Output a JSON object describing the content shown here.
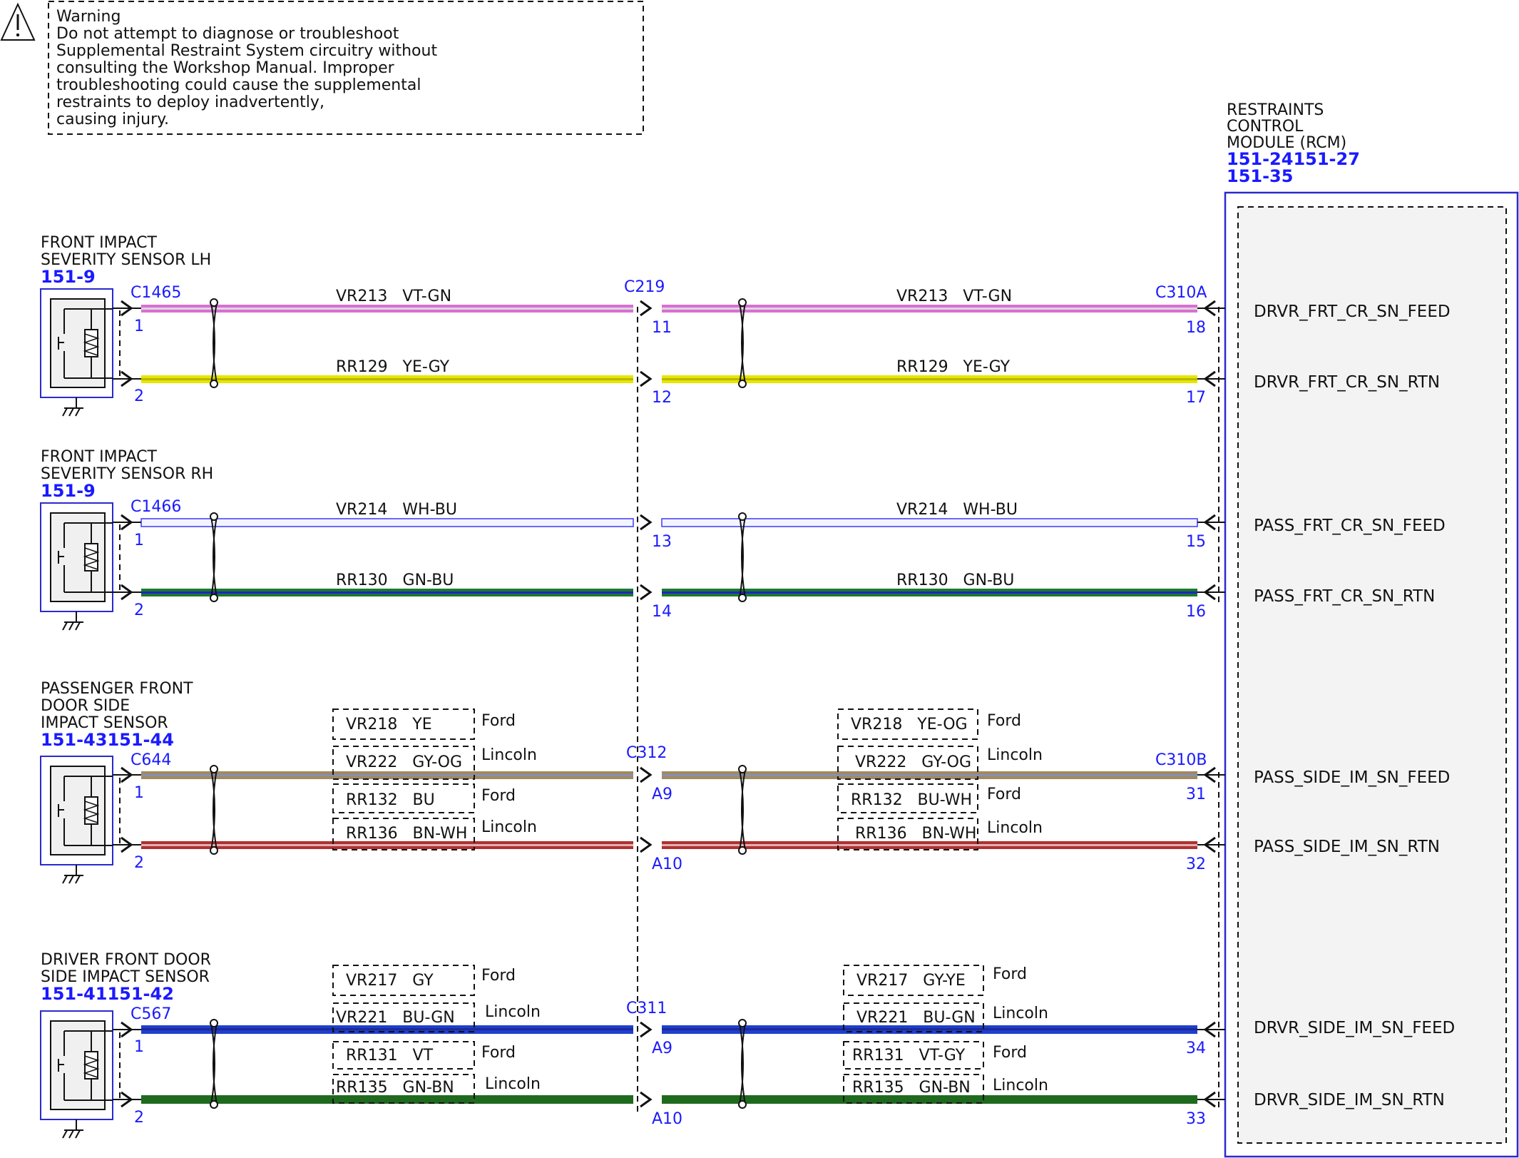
{
  "warning": {
    "lines": [
      "Warning",
      "Do not attempt to diagnose or troubleshoot",
      "Supplemental Restraint System circuitry without",
      "consulting the Workshop Manual. Improper",
      "troubleshooting could cause the supplemental",
      "restraints to deploy inadvertently,",
      "causing injury."
    ]
  },
  "rcm": {
    "title_lines": [
      "RESTRAINTS",
      "CONTROL",
      "MODULE (RCM)"
    ],
    "refs": [
      "151-24151-27",
      "151-35"
    ]
  },
  "sensors": [
    {
      "title_lines": [
        "FRONT IMPACT",
        "SEVERITY SENSOR LH"
      ],
      "ref": "151-9",
      "connector": "C1465",
      "inline_connector": "C219",
      "rcm_connector": "C310A",
      "wires": [
        {
          "pin_sensor": "1",
          "pin_inline_in": "",
          "pin_inline_out": "11",
          "pin_rcm": "18",
          "label_left": "VR213   VT-GN",
          "label_right": "VR213   VT-GN",
          "signal": "DRVR_FRT_CR_SN_FEED",
          "color_main": "#d96fd4",
          "color_stripe": "#d9d9d9"
        },
        {
          "pin_sensor": "2",
          "pin_inline_in": "",
          "pin_inline_out": "12",
          "pin_rcm": "17",
          "label_left": "RR129   YE-GY",
          "label_right": "RR129   YE-GY",
          "signal": "DRVR_FRT_CR_SN_RTN",
          "color_main": "#e6e600",
          "color_stripe": "#c8c8c8"
        }
      ]
    },
    {
      "title_lines": [
        "FRONT IMPACT",
        "SEVERITY SENSOR RH"
      ],
      "ref": "151-9",
      "connector": "C1466",
      "inline_connector": "",
      "rcm_connector": "",
      "wires": [
        {
          "pin_sensor": "1",
          "pin_inline_in": "",
          "pin_inline_out": "13",
          "pin_rcm": "15",
          "label_left": "VR214   WH-BU",
          "label_right": "VR214   WH-BU",
          "signal": "PASS_FRT_CR_SN_FEED",
          "color_main": "#f4f4ff",
          "color_stripe": "#3a3aff"
        },
        {
          "pin_sensor": "2",
          "pin_inline_in": "",
          "pin_inline_out": "14",
          "pin_rcm": "16",
          "label_left": "RR130   GN-BU",
          "label_right": "RR130   GN-BU",
          "signal": "PASS_FRT_CR_SN_RTN",
          "color_main": "#1a7a2a",
          "color_stripe": "#2222cc"
        }
      ]
    },
    {
      "title_lines": [
        "PASSENGER FRONT",
        "DOOR SIDE",
        "IMPACT SENSOR"
      ],
      "ref": "151-43151-44",
      "connector": "C644",
      "inline_connector": "C312",
      "rcm_connector": "C310B",
      "variants_left": [
        {
          "label": "VR218   YE",
          "brand": "Ford"
        },
        {
          "label": "VR222   GY-OG",
          "brand": "Lincoln"
        },
        {
          "label": "RR132   BU",
          "brand": "Ford"
        },
        {
          "label": "RR136   BN-WH",
          "brand": "Lincoln"
        }
      ],
      "variants_right": [
        {
          "label": "VR218   YE-OG",
          "brand": "Ford"
        },
        {
          "label": "VR222   GY-OG",
          "brand": "Lincoln"
        },
        {
          "label": "RR132   BU-WH",
          "brand": "Ford"
        },
        {
          "label": "RR136   BN-WH",
          "brand": "Lincoln"
        }
      ],
      "wires": [
        {
          "pin_sensor": "1",
          "pin_inline_out": "A9",
          "pin_rcm": "31",
          "signal": "PASS_SIDE_IM_SN_FEED",
          "color_main": "#a08a60",
          "color_stripe": "#8a8fb0"
        },
        {
          "pin_sensor": "2",
          "pin_inline_out": "A10",
          "pin_rcm": "32",
          "signal": "PASS_SIDE_IM_SN_RTN",
          "color_main": "#b03030",
          "color_stripe": "#d9a0a0"
        }
      ]
    },
    {
      "title_lines": [
        "DRIVER FRONT DOOR",
        "SIDE IMPACT SENSOR"
      ],
      "ref": "151-41151-42",
      "connector": "C567",
      "inline_connector": "C311",
      "rcm_connector": "",
      "variants_left": [
        {
          "label": "VR217   GY",
          "brand": "Ford"
        },
        {
          "label": "VR221   BU-GN",
          "brand": "Lincoln"
        },
        {
          "label": "RR131   VT",
          "brand": "Ford"
        },
        {
          "label": "RR135   GN-BN",
          "brand": "Lincoln"
        }
      ],
      "variants_right": [
        {
          "label": "VR217   GY-YE",
          "brand": "Ford"
        },
        {
          "label": "VR221   BU-GN",
          "brand": "Lincoln"
        },
        {
          "label": "RR131   VT-GY",
          "brand": "Ford"
        },
        {
          "label": "RR135   GN-BN",
          "brand": "Lincoln"
        }
      ],
      "wires": [
        {
          "pin_sensor": "1",
          "pin_inline_out": "A9",
          "pin_rcm": "34",
          "signal": "DRVR_SIDE_IM_SN_FEED",
          "color_main": "#1f3fcc",
          "color_stripe": "#1f8a3a"
        },
        {
          "pin_sensor": "2",
          "pin_inline_out": "A10",
          "pin_rcm": "33",
          "signal": "DRVR_SIDE_IM_SN_RTN",
          "color_main": "#1f6a1f",
          "color_stripe": "#1f6a1f"
        }
      ]
    }
  ],
  "colors": {
    "ref_blue": "#1a1aff",
    "module_border": "#2a2acc",
    "module_fill": "#f3f3f3",
    "line": "#111111"
  },
  "icons": {
    "warning": "warning-triangle-icon",
    "ground": "ground-icon",
    "sensor": "impact-sensor-icon"
  }
}
